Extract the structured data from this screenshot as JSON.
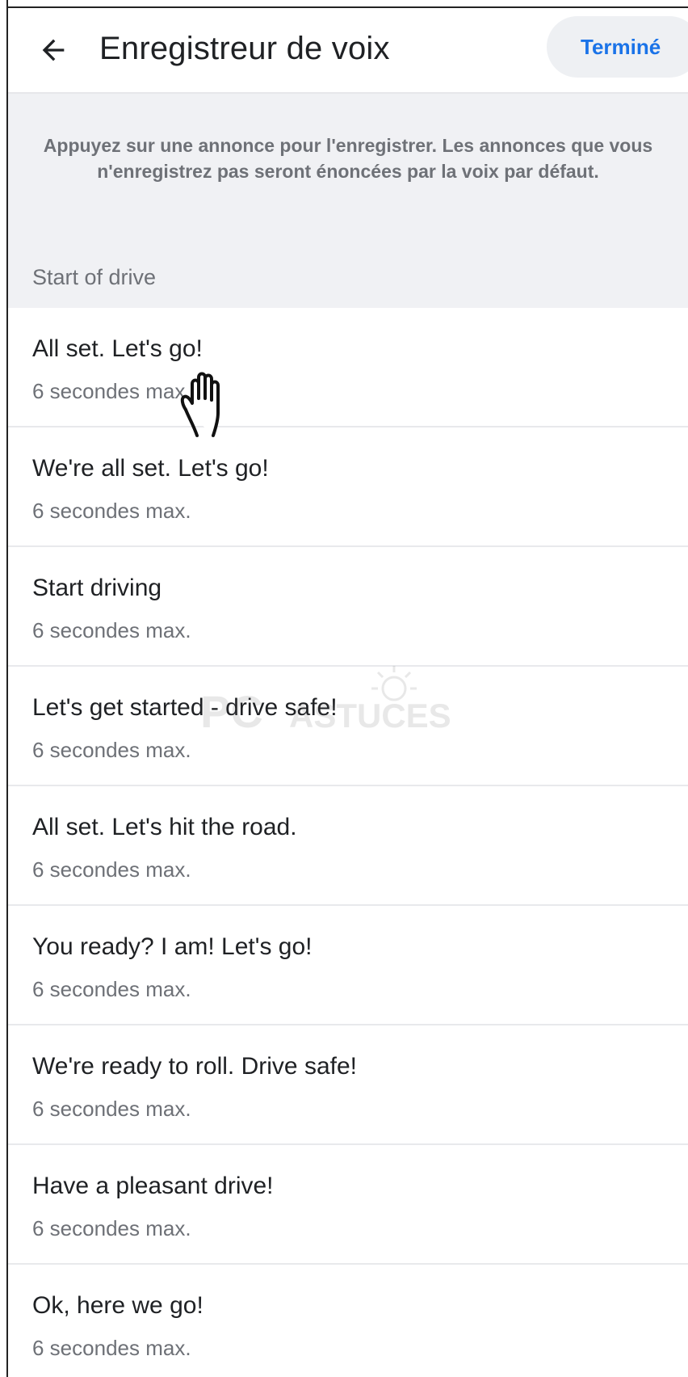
{
  "header": {
    "title": "Enregistreur de voix",
    "done_label": "Terminé"
  },
  "info": {
    "description": "Appuyez sur une annonce pour l'enregistrer. Les annonces que vous n'enregistrez pas seront énoncées par la voix par défaut.",
    "section_label": "Start of drive"
  },
  "items": [
    {
      "title": "All set. Let's go!",
      "subtitle": "6 secondes max."
    },
    {
      "title": "We're all set. Let's go!",
      "subtitle": "6 secondes max."
    },
    {
      "title": "Start driving",
      "subtitle": "6 secondes max."
    },
    {
      "title": "Let's get started - drive safe!",
      "subtitle": "6 secondes max."
    },
    {
      "title": "All set. Let's hit the road.",
      "subtitle": "6 secondes max."
    },
    {
      "title": "You ready? I am! Let's go!",
      "subtitle": "6 secondes max."
    },
    {
      "title": "We're ready to roll. Drive safe!",
      "subtitle": "6 secondes max."
    },
    {
      "title": "Have a pleasant drive!",
      "subtitle": "6 secondes max."
    },
    {
      "title": "Ok, here we go!",
      "subtitle": "6 secondes max."
    }
  ],
  "watermark": {
    "text_pc": "PC",
    "text_astuces": "ASTUCES"
  },
  "colors": {
    "accent": "#1a73e8",
    "text_primary": "#1f2124",
    "text_secondary": "#6e7177",
    "panel_bg": "#f0f1f4"
  },
  "icons": {
    "back": "arrow-left-icon",
    "pointer": "hand-pointer-icon"
  }
}
